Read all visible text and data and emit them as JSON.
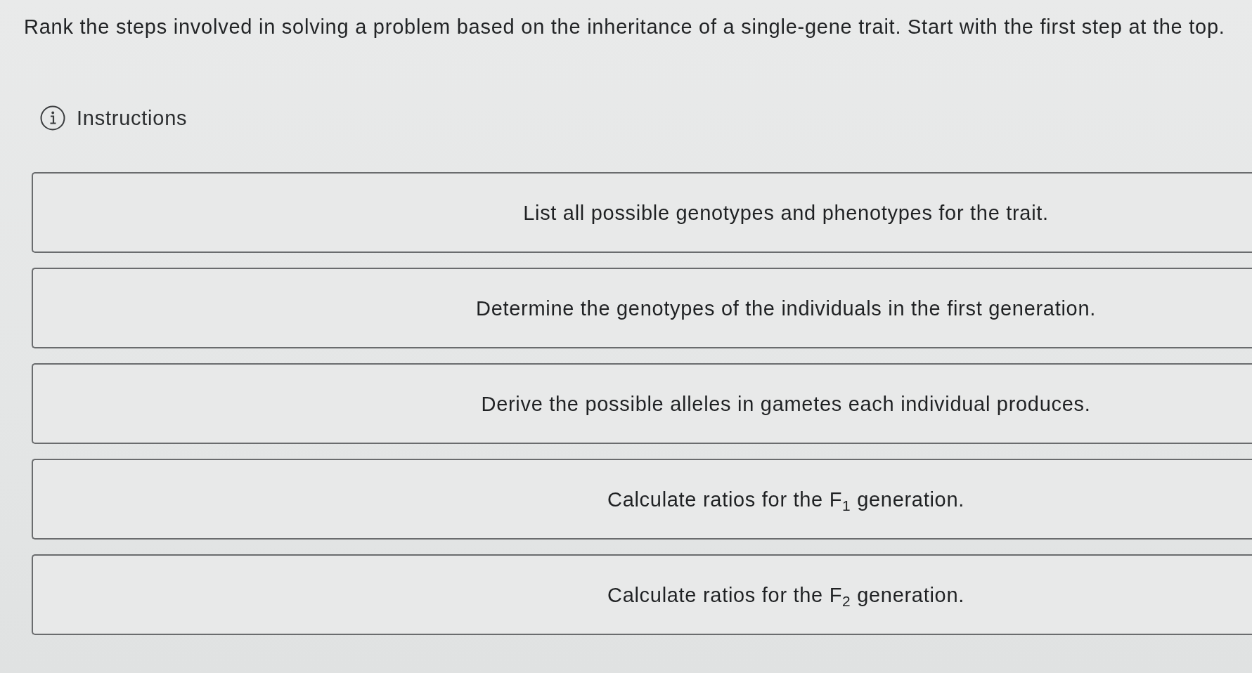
{
  "prompt": "Rank the steps involved in solving a problem based on the inheritance of a single-gene trait. Start with the first step at the top.",
  "instructions": {
    "label": "Instructions"
  },
  "steps": [
    "List all possible genotypes and phenotypes for the trait.",
    "Determine the genotypes of the individuals in the first generation.",
    "Derive the possible alleles in gametes each individual produces.",
    "Calculate ratios for the F$_{1}$ generation.",
    "Calculate ratios for the F$_{2}$ generation."
  ]
}
